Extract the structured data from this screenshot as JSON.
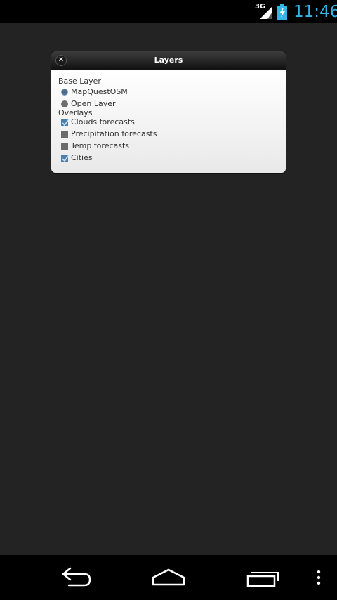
{
  "status_bar": {
    "network_type": "3G",
    "time": "11:46",
    "icons": [
      "signal-icon",
      "battery-charging-icon"
    ]
  },
  "dialog": {
    "title": "Layers",
    "close_icon": "close-icon",
    "base_layer_label": "Base Layer",
    "base_layers": [
      {
        "label": "MapQuestOSM",
        "selected": true
      },
      {
        "label": "Open Layer",
        "selected": false
      }
    ],
    "overlays_label": "Overlays",
    "overlays": [
      {
        "label": "Clouds forecasts",
        "checked": true
      },
      {
        "label": "Precipitation forecasts",
        "checked": false
      },
      {
        "label": "Temp forecasts",
        "checked": false
      },
      {
        "label": "Cities",
        "checked": true
      }
    ]
  },
  "nav_bar": {
    "icons": [
      "back-icon",
      "home-icon",
      "recent-apps-icon",
      "menu-icon"
    ]
  },
  "colors": {
    "background": "#232323",
    "status_time": "#33b5e5",
    "radio_selected": "#4e6d8d",
    "checkbox_checked": "#4d7fa8"
  }
}
